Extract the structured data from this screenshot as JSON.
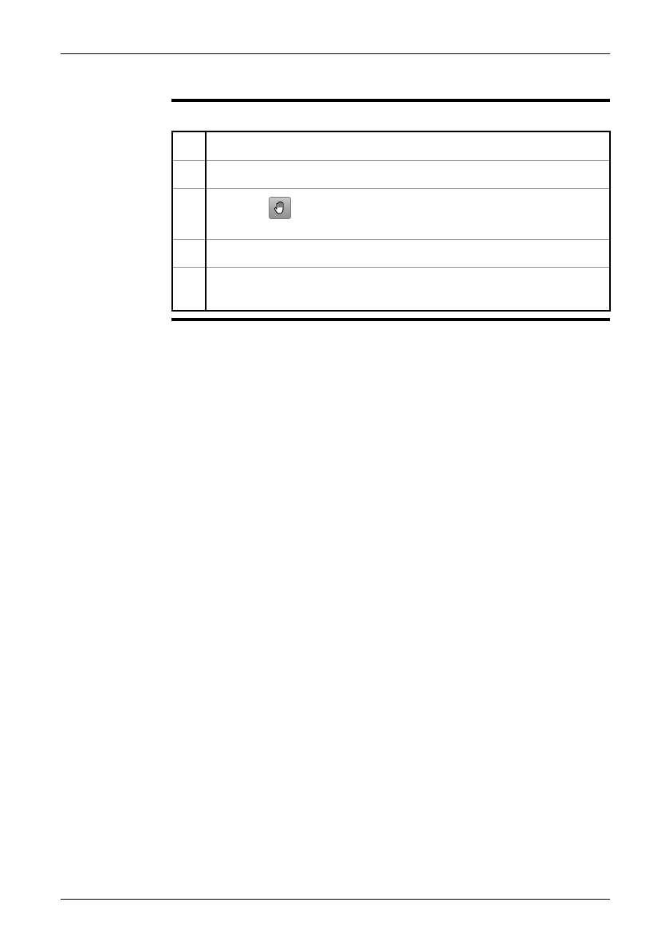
{
  "steps": [
    {
      "number": "",
      "text": ""
    },
    {
      "number": "",
      "text": ""
    },
    {
      "number": "",
      "text": "",
      "icon": "pan-hand-icon"
    },
    {
      "number": "",
      "text": ""
    },
    {
      "number": "",
      "text": ""
    }
  ],
  "colors": {
    "rule": "#000000",
    "row_divider": "#9a9a9a",
    "icon_bg": "#a5a5a5"
  }
}
